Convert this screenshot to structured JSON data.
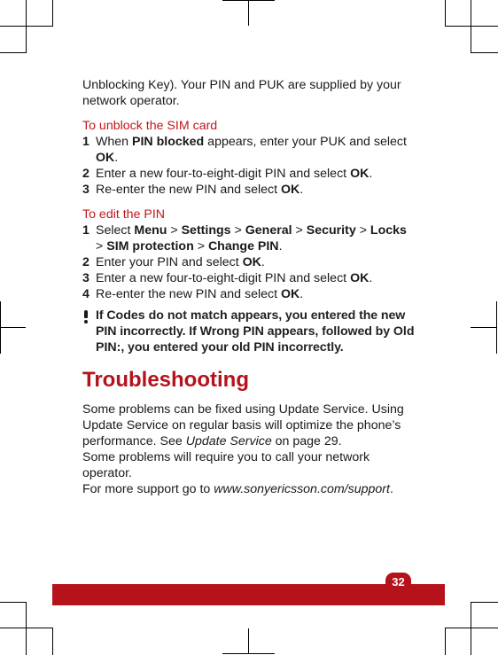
{
  "intro": {
    "text": "Unblocking Key). Your PIN and PUK are supplied by your network operator."
  },
  "unblock": {
    "title": "To unblock the SIM card",
    "steps": [
      {
        "num": "1",
        "parts": [
          "When ",
          "PIN blocked",
          " appears, enter your PUK and select ",
          "OK",
          "."
        ]
      },
      {
        "num": "2",
        "parts": [
          "Enter a new four-to-eight-digit PIN and select ",
          "OK",
          "."
        ]
      },
      {
        "num": "3",
        "parts": [
          "Re-enter the new PIN and select ",
          "OK",
          "."
        ]
      }
    ]
  },
  "edit_pin": {
    "title": "To edit the PIN",
    "steps": [
      {
        "num": "1",
        "parts": [
          "Select ",
          "Menu",
          " > ",
          "Settings",
          " > ",
          "General",
          " > ",
          "Security",
          " > ",
          "Locks",
          " > ",
          "SIM protection",
          " > ",
          "Change PIN",
          "."
        ]
      },
      {
        "num": "2",
        "parts": [
          "Enter your PIN and select ",
          "OK",
          "."
        ]
      },
      {
        "num": "3",
        "parts": [
          "Enter a new four-to-eight-digit PIN and select ",
          "OK",
          "."
        ]
      },
      {
        "num": "4",
        "parts": [
          "Re-enter the new PIN and select ",
          "OK",
          "."
        ]
      }
    ]
  },
  "note": {
    "icon": "exclamation-icon",
    "parts": [
      "If ",
      "Codes do not match",
      " appears, you entered the new PIN incorrectly. If ",
      "Wrong PIN",
      " appears, followed by ",
      "Old PIN:",
      ", you entered your old PIN incorrectly."
    ]
  },
  "troubleshooting": {
    "title": "Troubleshooting",
    "para1_a": "Some problems can be fixed using Update Service. Using Update Service on regular basis will optimize the phone’s performance. See ",
    "para1_link": "Update Service",
    "para1_b": " on page 29.",
    "para2": "Some problems will require you to call your network operator.",
    "para3_a": "For more support go to ",
    "para3_link": "www.sonyericsson.com/support",
    "para3_b": "."
  },
  "footer": {
    "page_number": "32"
  },
  "colors": {
    "accent_red": "#b5121b",
    "subhead_red": "#c4161c",
    "text": "#1a1a1a"
  }
}
